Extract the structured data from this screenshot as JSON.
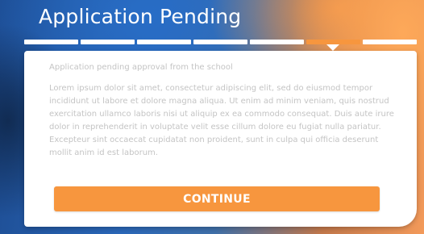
{
  "header": {
    "title": "Application Pending"
  },
  "progress": {
    "total_steps": 7,
    "active_step": 6,
    "active_color": "#f7963e",
    "inactive_color": "#ffffff"
  },
  "card": {
    "subtitle": "Application pending approval from the school",
    "body": "Lorem ipsum dolor sit amet, consectetur adipiscing elit, sed do eiusmod tempor incididunt ut labore et dolore magna aliqua. Ut enim ad minim veniam, quis nostrud exercitation ullamco laboris nisi ut aliquip ex ea commodo consequat. Duis aute irure dolor in reprehenderit in voluptate velit esse cillum dolore eu fugiat nulla pariatur. Excepteur sint occaecat cupidatat non proident, sunt in culpa qui officia deserunt mollit anim id est laborum.",
    "continue_label": "CONTINUE",
    "button_color": "#f7963e"
  }
}
